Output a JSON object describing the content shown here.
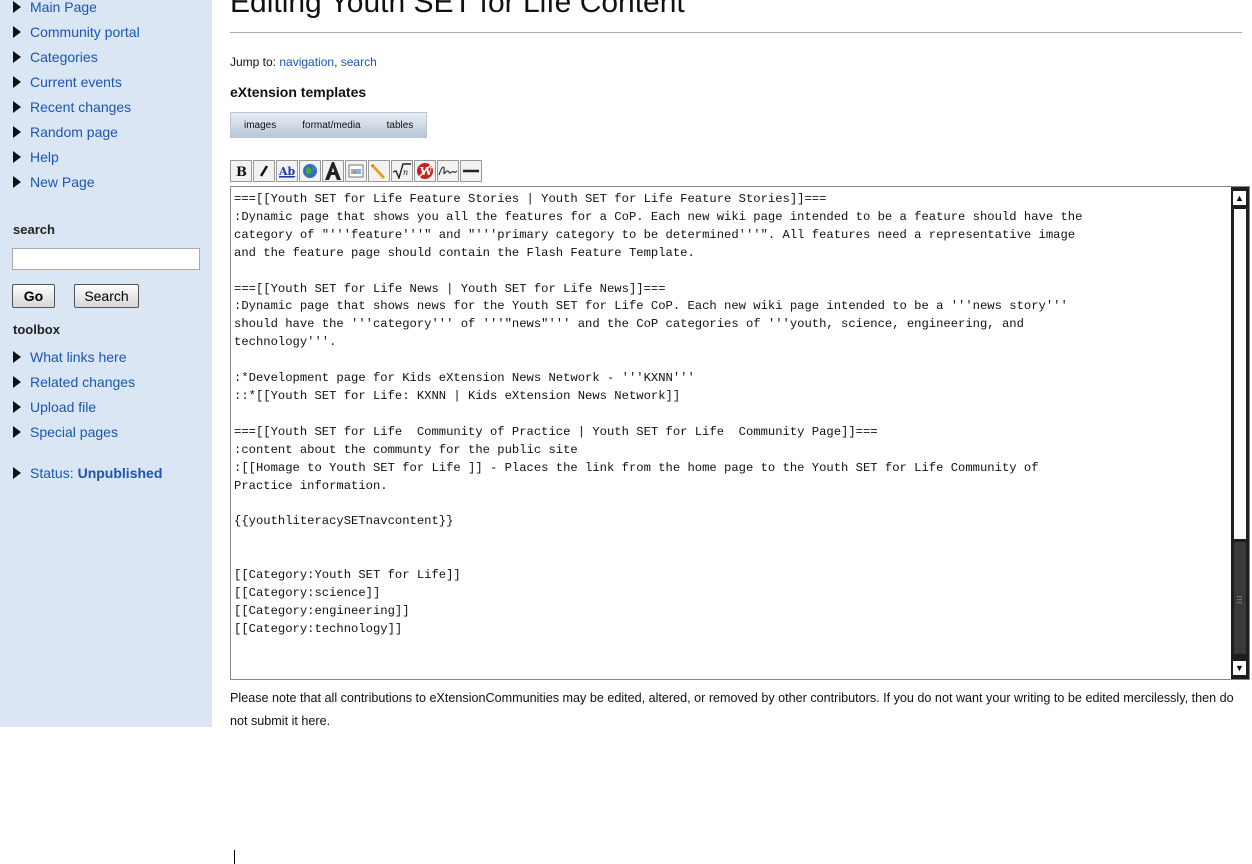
{
  "title": "Editing Youth SET for Life Content",
  "sidebar": {
    "nav_items": [
      "Main Page",
      "Community portal",
      "Categories",
      "Current events",
      "Recent changes",
      "Random page",
      "Help",
      "New Page"
    ],
    "search_heading": "search",
    "search_value": "",
    "go_label": "Go",
    "search_label": "Search",
    "toolbox_heading": "toolbox",
    "toolbox_items": [
      "What links here",
      "Related changes",
      "Upload file",
      "Special pages"
    ],
    "status_label": "Status: ",
    "status_value": "Unpublished"
  },
  "jump": {
    "prefix": "Jump to: ",
    "navigation": "navigation",
    "separator": ", ",
    "search": "search"
  },
  "templates": {
    "heading": "eXtension templates",
    "tabs": [
      "images",
      "format/media",
      "tables"
    ]
  },
  "toolbar_icons": [
    "bold-icon",
    "italic-icon",
    "internal-link-icon",
    "external-link-icon",
    "headline-icon",
    "embedded-image-icon",
    "media-link-icon",
    "math-formula-icon",
    "nowiki-icon",
    "signature-icon",
    "horizontal-line-icon"
  ],
  "editor": {
    "text": "===[[Youth SET for Life Feature Stories | Youth SET for Life Feature Stories]]===\n:Dynamic page that shows you all the features for a CoP. Each new wiki page intended to be a feature should have the\ncategory of \"'''feature'''\" and \"'''primary category to be determined'''\". All features need a representative image\nand the feature page should contain the Flash Feature Template.\n\n===[[Youth SET for Life News | Youth SET for Life News]]===\n:Dynamic page that shows news for the Youth SET for Life CoP. Each new wiki page intended to be a '''news story'''\nshould have the '''category''' of '''\"news\"''' and the CoP categories of '''youth, science, engineering, and\ntechnology'''.\n\n:*Development page for Kids eXtension News Network - '''KXNN'''\n::*[[Youth SET for Life: KXNN | Kids eXtension News Network]]\n\n===[[Youth SET for Life  Community of Practice | Youth SET for Life  Community Page]]===\n:content about the communty for the public site\n:[[Homage to Youth SET for Life ]] - Places the link from the home page to the Youth SET for Life Community of\nPractice information.\n\n{{youthliteracySETnavcontent}}\n\n\n[[Category:Youth SET for Life]]\n[[Category:science]]\n[[Category:engineering]]\n[[Category:technology]]"
  },
  "note": "Please note that all contributions to eXtensionCommunities may be edited, altered, or removed by other contributors. If you do not want your writing to be edited mercilessly, then do not submit it here."
}
